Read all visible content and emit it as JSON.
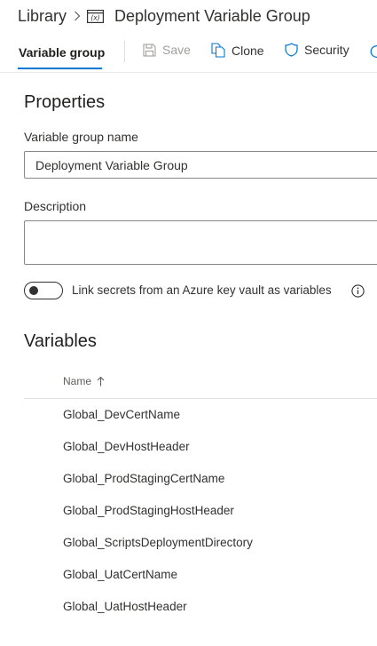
{
  "breadcrumb": {
    "library": "Library",
    "current": "Deployment Variable Group"
  },
  "toolbar": {
    "tab_label": "Variable group",
    "save_label": "Save",
    "clone_label": "Clone",
    "security_label": "Security"
  },
  "properties": {
    "heading": "Properties",
    "name_label": "Variable group name",
    "name_value": "Deployment Variable Group",
    "description_label": "Description",
    "description_value": "",
    "keyvault_toggle_label": "Link secrets from an Azure key vault as variables",
    "keyvault_toggle_on": false
  },
  "variables": {
    "heading": "Variables",
    "column_name": "Name",
    "sort": "ascending",
    "rows": [
      "Global_DevCertName",
      "Global_DevHostHeader",
      "Global_ProdStagingCertName",
      "Global_ProdStagingHostHeader",
      "Global_ScriptsDeploymentDirectory",
      "Global_UatCertName",
      "Global_UatHostHeader"
    ]
  },
  "colors": {
    "accent": "#0078d4",
    "text": "#323130",
    "disabled": "#a19f9d"
  }
}
